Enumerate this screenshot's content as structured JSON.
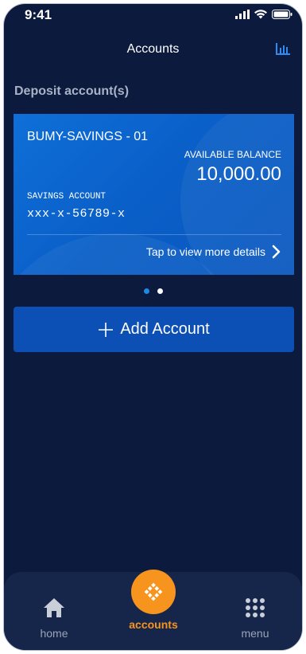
{
  "status_bar": {
    "time": "9:41"
  },
  "header": {
    "title": "Accounts",
    "stats_icon": "bar-chart-icon"
  },
  "section": {
    "title": "Deposit account(s)"
  },
  "account_card": {
    "name": "BUMY-SAVINGS - 01",
    "available_label": "AVAILABLE BALANCE",
    "available_amount": "10,000.00",
    "account_type": "SAVINGS ACCOUNT",
    "account_number": "xxx-x-56789-x",
    "details_label": "Tap to view more details"
  },
  "pager": {
    "total": 2,
    "active_index": 0
  },
  "add_account": {
    "label": "Add Account",
    "icon": "plus-icon"
  },
  "bottom_nav": {
    "items": [
      {
        "label": "home",
        "icon": "home-icon"
      },
      {
        "label": "accounts",
        "icon": "accounts-logo-icon"
      },
      {
        "label": "menu",
        "icon": "grid-menu-icon"
      }
    ],
    "active_index": 1
  },
  "colors": {
    "background": "#0b1a3d",
    "card": "#0a5ec7",
    "accent": "#f7941d",
    "button": "#0c4fb5",
    "active_dot": "#1e88e5",
    "nav_bar": "#16264a"
  }
}
